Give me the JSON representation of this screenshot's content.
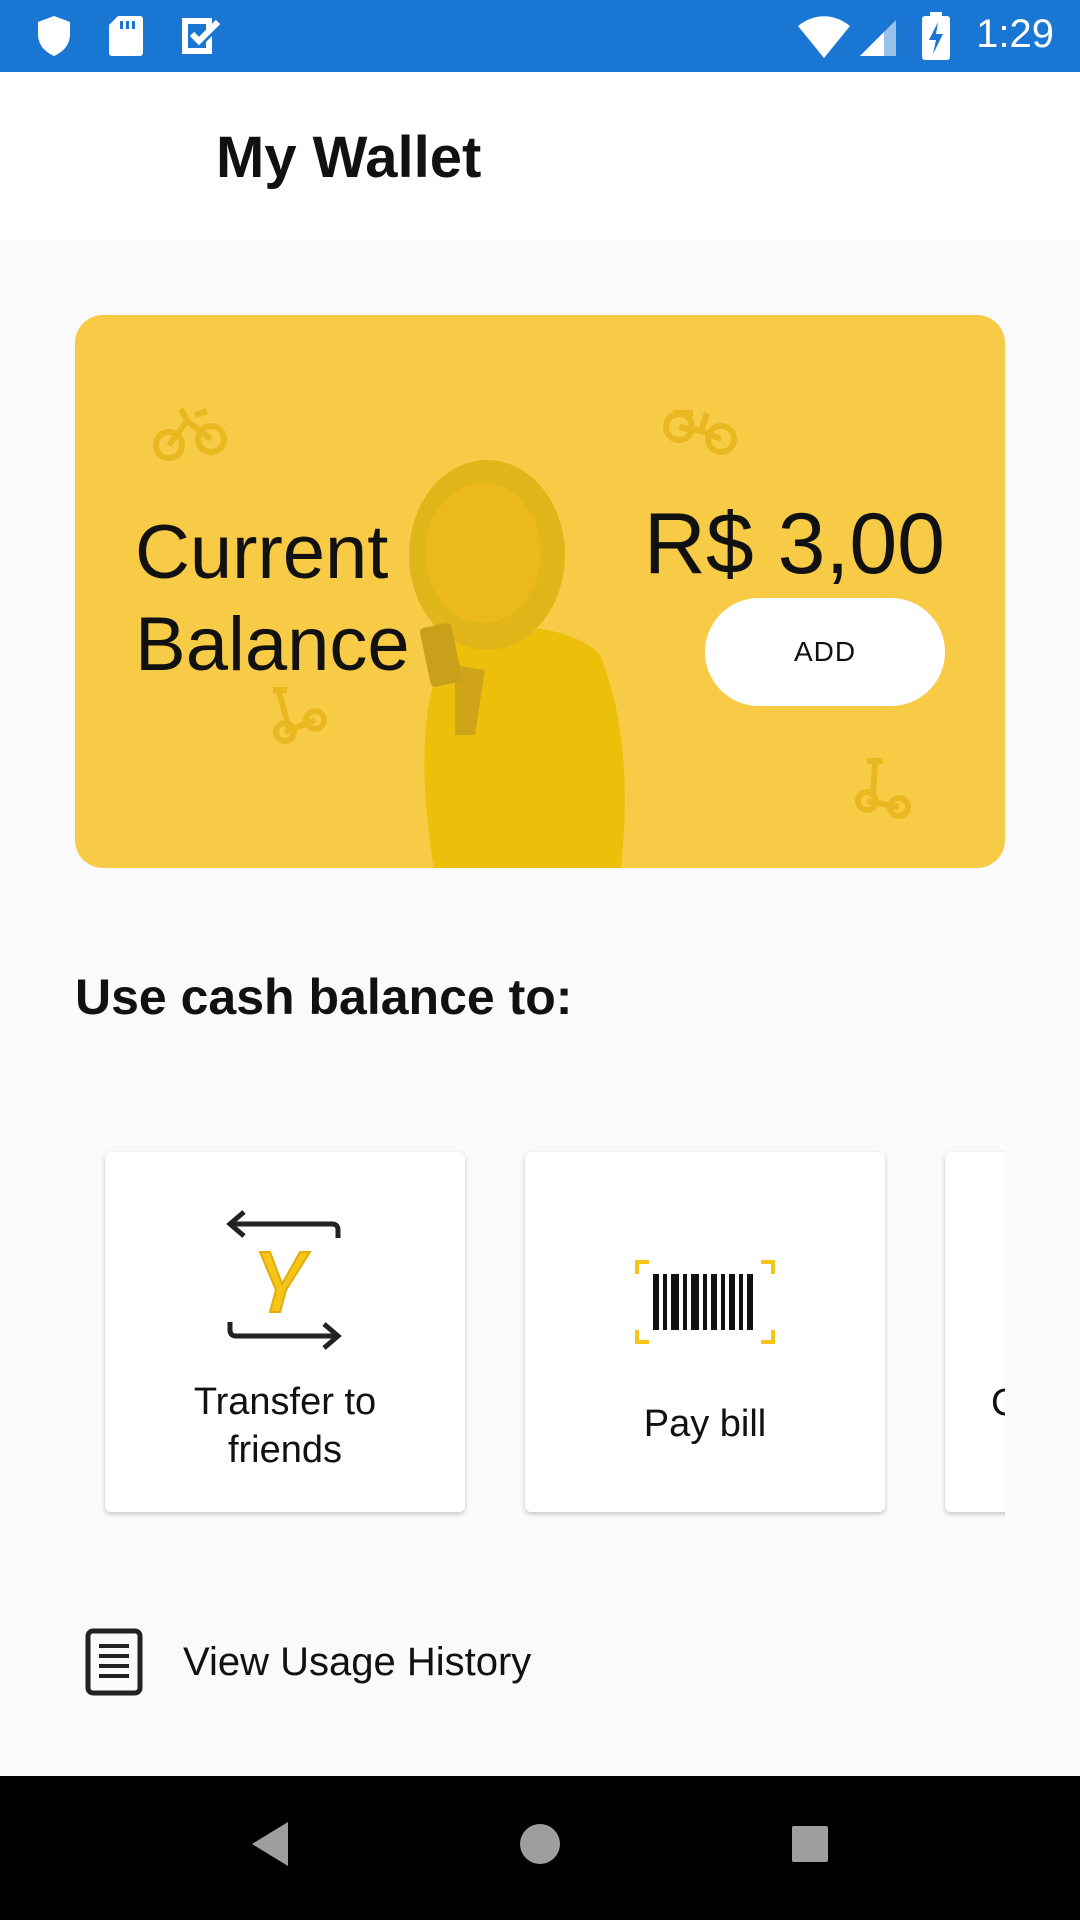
{
  "status_bar": {
    "time": "1:29",
    "left_icons": [
      "shield-icon",
      "sd-card-icon",
      "check-box-icon"
    ],
    "right_icons": [
      "wifi-icon",
      "cellular-signal-icon",
      "battery-charging-icon"
    ]
  },
  "app_bar": {
    "title": "My Wallet"
  },
  "balance_card": {
    "label_line1": "Current",
    "label_line2": "Balance",
    "amount": "R$ 3,00",
    "add_label": "ADD",
    "background_color": "#f7cb46"
  },
  "section": {
    "title": "Use cash balance to:"
  },
  "actions": [
    {
      "label_line1": "Transfer to",
      "label_line2": "friends",
      "icon": "transfer-icon"
    },
    {
      "label": "Pay bill",
      "icon": "barcode-icon"
    },
    {
      "label_partial": "C"
    }
  ],
  "history": {
    "label": "View Usage History",
    "icon": "document-icon"
  },
  "nav_bar": {
    "buttons": [
      "back-icon",
      "home-icon",
      "recents-icon"
    ]
  },
  "colors": {
    "status_bar": "#1976d2",
    "accent_yellow": "#f7cb46",
    "icon_yellow": "#f5c518"
  }
}
